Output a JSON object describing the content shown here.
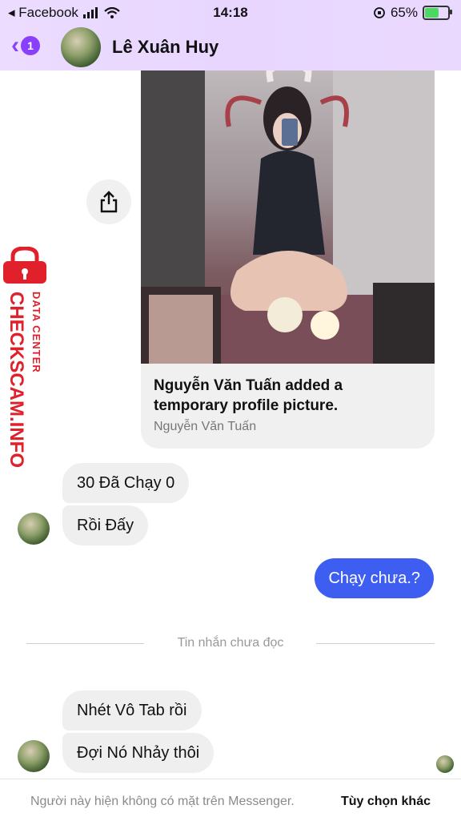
{
  "status_bar": {
    "carrier": "◂ Facebook",
    "time": "14:18",
    "battery_percent": "65%",
    "battery_level": 0.65
  },
  "header": {
    "back_badge": "1",
    "contact_name": "Lê Xuân Huy"
  },
  "shared_post": {
    "caption": "Nguyễn Văn Tuấn added a temporary profile picture.",
    "author": "Nguyễn Văn Tuấn"
  },
  "messages": {
    "incoming_1": "30 Đã Chạy 0",
    "incoming_2": "Rồi Đấy",
    "outgoing_1": "Chạy chưa.?",
    "unread_divider": "Tin nhắn chưa đọc",
    "incoming_3": "Nhét Vô Tab rồi",
    "incoming_4": "Đợi Nó Nhảy thôi"
  },
  "footer": {
    "status_text": "Người này hiện không có mặt trên Messenger.",
    "more_options": "Tùy chọn khác"
  },
  "watermark": {
    "line1": "DATA CENTER",
    "line2": "CHECKSCAM.INFO"
  },
  "colors": {
    "accent": "#8a3ffc",
    "outgoing_bubble": "#3e5ef2",
    "watermark_red": "#e0202a"
  }
}
